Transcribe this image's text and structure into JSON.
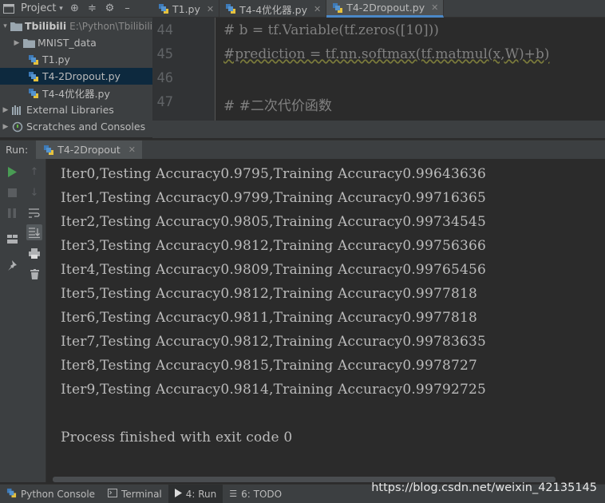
{
  "project_panel": {
    "title": "Project",
    "tree": [
      {
        "label": "Tbilibili",
        "path": "E:\\Python\\Tbilibili",
        "type": "folder",
        "expanded": true
      },
      {
        "label": "MNIST_data",
        "type": "folder",
        "expanded": false
      },
      {
        "label": "T1.py",
        "type": "python"
      },
      {
        "label": "T4-2Dropout.py",
        "type": "python",
        "selected": true
      },
      {
        "label": "T4-4优化器.py",
        "type": "python"
      },
      {
        "label": "External Libraries",
        "type": "library"
      },
      {
        "label": "Scratches and Consoles",
        "type": "scratch"
      }
    ]
  },
  "editor": {
    "tabs": [
      {
        "label": "T1.py",
        "active": false
      },
      {
        "label": "T4-4优化器.py",
        "active": false
      },
      {
        "label": "T4-2Dropout.py",
        "active": true
      }
    ],
    "lines": [
      {
        "num": "44",
        "text": "# b = tf.Variable(tf.zeros([10]))"
      },
      {
        "num": "45",
        "text": "#prediction = tf.nn.softmax(tf.matmul(x,W)+b)"
      },
      {
        "num": "46",
        "text": ""
      },
      {
        "num": "47",
        "text": "# #二次代价函数"
      }
    ]
  },
  "run_panel": {
    "label": "Run:",
    "tab_label": "T4-2Dropout",
    "output": [
      "Iter0,Testing Accuracy0.9795,Training Accuracy0.99643636",
      "Iter1,Testing Accuracy0.9799,Training Accuracy0.99716365",
      "Iter2,Testing Accuracy0.9805,Training Accuracy0.99734545",
      "Iter3,Testing Accuracy0.9812,Training Accuracy0.99756366",
      "Iter4,Testing Accuracy0.9809,Training Accuracy0.99765456",
      "Iter5,Testing Accuracy0.9812,Training Accuracy0.9977818",
      "Iter6,Testing Accuracy0.9811,Training Accuracy0.9977818",
      "Iter7,Testing Accuracy0.9812,Training Accuracy0.99783635",
      "Iter8,Testing Accuracy0.9815,Training Accuracy0.9978727",
      "Iter9,Testing Accuracy0.9814,Training Accuracy0.99792725",
      "",
      "Process finished with exit code 0"
    ]
  },
  "bottom_bar": {
    "tabs": [
      {
        "label": "Python Console",
        "active": false
      },
      {
        "label": "Terminal",
        "active": false
      },
      {
        "label": "4: Run",
        "active": true
      },
      {
        "label": "6: TODO",
        "active": false
      }
    ]
  },
  "watermark": "https://blog.csdn.net/weixin_42135145",
  "colors": {
    "panel_bg": "#3c3f41",
    "editor_bg": "#2b2b2b",
    "selection": "#0d293e",
    "accent": "#4a88c7",
    "run_green": "#499c54"
  }
}
